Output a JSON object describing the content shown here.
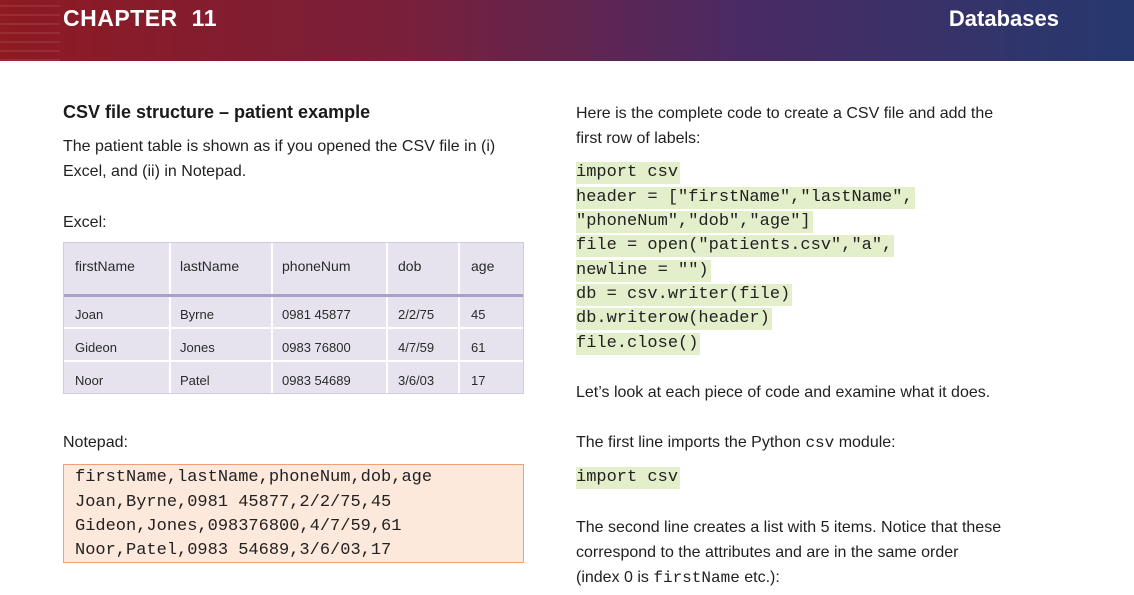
{
  "header": {
    "chapter_label": "CHAPTER",
    "chapter_num": "11",
    "section": "Databases"
  },
  "left": {
    "heading": "CSV file structure – patient example",
    "intro_line1": "The patient table is shown as if you opened the CSV file in (i)",
    "intro_line2": "Excel, and (ii) in Notepad.",
    "excel_label": "Excel:",
    "table": {
      "headers": [
        "firstName",
        "lastName",
        "phoneNum",
        "dob",
        "age"
      ],
      "rows": [
        [
          "Joan",
          "Byrne",
          "0981 45877",
          "2/2/75",
          "45"
        ],
        [
          "Gideon",
          "Jones",
          "0983 76800",
          "4/7/59",
          "61"
        ],
        [
          "Noor",
          "Patel",
          "0983 54689",
          "3/6/03",
          "17"
        ]
      ]
    },
    "notepad_label": "Notepad:",
    "notepad_lines": [
      "firstName,lastName,phoneNum,dob,age",
      "Joan,Byrne,0981 45877,2/2/75,45",
      "Gideon,Jones,098376800,4/7/59,61",
      "Noor,Patel,0983 54689,3/6/03,17"
    ]
  },
  "right": {
    "intro_line1": "Here is the complete code to create a CSV file and add the",
    "intro_line2": "first row of labels:",
    "code_lines": [
      "import csv",
      "header = [\"firstName\",\"lastName\",",
      "\"phoneNum\",\"dob\",\"age\"]",
      "file = open(\"patients.csv\",\"a\",",
      "newline = \"\")",
      "db = csv.writer(file)",
      "db.writerow(header)",
      "file.close()"
    ],
    "look_text": "Let’s look at each piece of code and examine what it does.",
    "first_line_pre": "The first line imports the Python ",
    "first_line_code": "csv",
    "first_line_post": " module:",
    "import_code": "import csv",
    "second_line1": "The second line creates a list with 5 items. Notice that these",
    "second_line2": "correspond to the attributes and are in the same order",
    "second_line3_pre": "(index 0 is ",
    "second_line3_code": "firstName",
    "second_line3_post": " etc.):"
  }
}
